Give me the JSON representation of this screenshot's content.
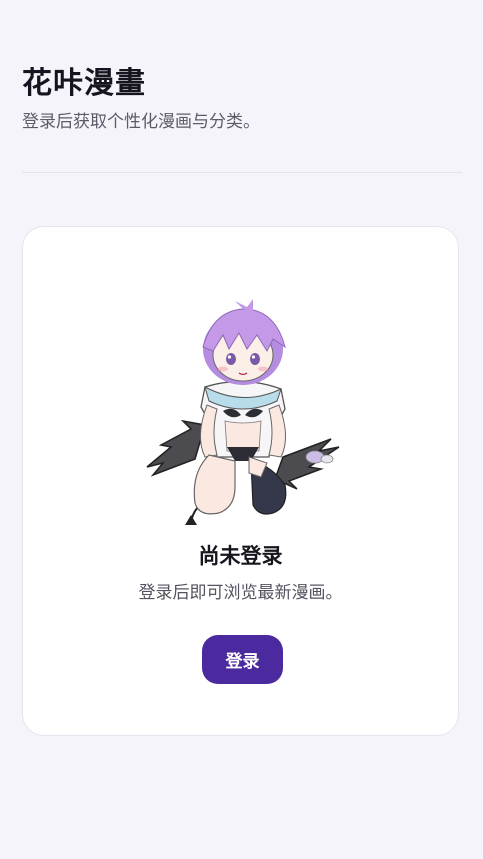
{
  "header": {
    "title": "花咔漫畫",
    "subtitle": "登录后获取个性化漫画与分类。"
  },
  "empty_state": {
    "illustration": "chibi-character-with-bat-wings-illustration",
    "title": "尚未登录",
    "description": "登录后即可浏览最新漫画。",
    "button_label": "登录"
  },
  "colors": {
    "background": "#f4f4fa",
    "card": "#ffffff",
    "accent": "#4a2a9e"
  }
}
